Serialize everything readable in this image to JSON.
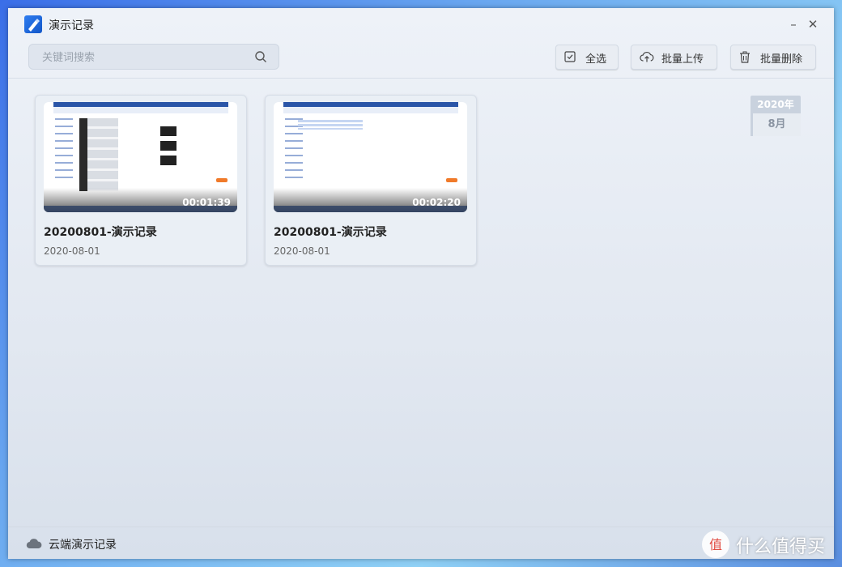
{
  "window": {
    "title": "演示记录",
    "min_symbol": "–",
    "close_symbol": "✕"
  },
  "search": {
    "placeholder": "关键词搜索",
    "value": ""
  },
  "toolbar": {
    "select_all_label": "全选",
    "batch_upload_label": "批量上传",
    "batch_delete_label": "批量删除"
  },
  "recordings": [
    {
      "title": "20200801-演示记录",
      "date": "2020-08-01",
      "duration": "00:01:39"
    },
    {
      "title": "20200801-演示记录",
      "date": "2020-08-01",
      "duration": "00:02:20"
    }
  ],
  "timeline": {
    "year": "2020年",
    "month": "8月"
  },
  "footer": {
    "cloud_label": "云端演示记录"
  },
  "watermark": {
    "text": "什么值得买",
    "logo_char": "值"
  },
  "icons": {
    "app": "presentation-pen-icon",
    "search": "search-icon",
    "select_all": "checkbox-icon",
    "upload": "cloud-upload-icon",
    "delete": "trash-icon",
    "cloud": "cloud-icon"
  },
  "colors": {
    "accent": "#1c6fe6",
    "window_bg": "#e8edf4"
  }
}
